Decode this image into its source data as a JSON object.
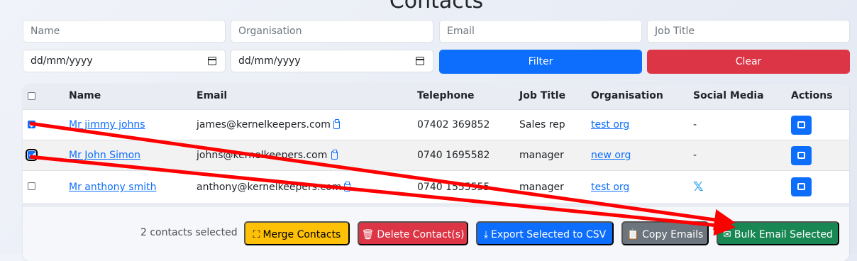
{
  "page": {
    "title": "Contacts"
  },
  "filters": {
    "name_placeholder": "Name",
    "organisation_placeholder": "Organisation",
    "email_placeholder": "Email",
    "job_title_placeholder": "Job Title",
    "date_from_placeholder": "dd/mm/yyyy",
    "date_to_placeholder": "dd/mm/yyyy",
    "filter_label": "Filter",
    "clear_label": "Clear"
  },
  "table": {
    "headers": [
      "Name",
      "Email",
      "Telephone",
      "Job Title",
      "Organisation",
      "Social Media",
      "Actions"
    ],
    "rows": [
      {
        "checked": true,
        "name": "Mr jimmy johns",
        "email": "james@kernelkeepers.com",
        "telephone": "07402 369852",
        "job_title": "Sales rep",
        "organisation": "test org",
        "social": "-"
      },
      {
        "checked": true,
        "name": "Mr John Simon",
        "email": "johns@kernelkeepers.com",
        "telephone": "0740 1695582",
        "job_title": "manager",
        "organisation": "new org",
        "social": "-"
      },
      {
        "checked": false,
        "name": "Mr anthony smith",
        "email": "anthony@kernelkeepers.com",
        "telephone": "0740 1555555",
        "job_title": "manager",
        "organisation": "test org",
        "social": "x-icon"
      }
    ]
  },
  "footer": {
    "selected_count": "2 contacts selected",
    "merge_label": "Merge Contacts",
    "delete_label": "Delete Contact(s)",
    "export_label": "Export Selected to CSV",
    "copy_label": "Copy Emails",
    "bulk_email_label": "Bulk Email Selected"
  },
  "colors": {
    "primary": "#0d6efd",
    "danger": "#dc3545",
    "warning": "#ffc107",
    "secondary": "#6c757d",
    "success": "#198754",
    "annotation_arrow": "#ff0000"
  }
}
